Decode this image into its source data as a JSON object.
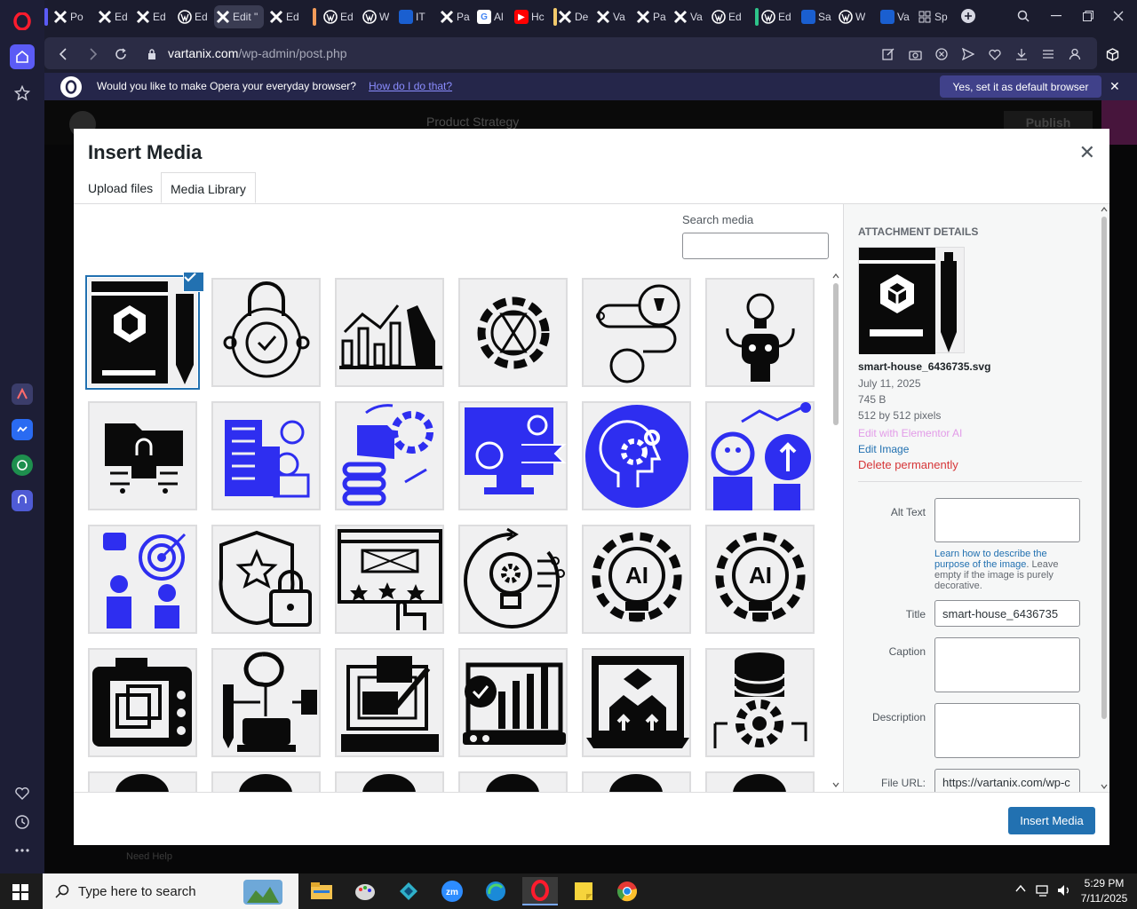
{
  "browser": {
    "tabs": [
      {
        "label": "Po",
        "icon": "elementor-x-icon"
      },
      {
        "label": "Ed",
        "icon": "elementor-x-icon"
      },
      {
        "label": "Ed",
        "icon": "elementor-x-icon"
      },
      {
        "label": "Ed",
        "icon": "wordpress-icon"
      },
      {
        "label": "Edit \"",
        "icon": "elementor-x-icon"
      },
      {
        "label": "Ed",
        "icon": "elementor-x-icon"
      },
      {
        "label": "Ed",
        "icon": "wordpress-icon"
      },
      {
        "label": "W",
        "icon": "wordpress-icon"
      },
      {
        "label": "IT",
        "icon": "blue-square-icon"
      },
      {
        "label": "Pa",
        "icon": "elementor-x-icon"
      },
      {
        "label": "Al",
        "icon": "google-icon"
      },
      {
        "label": "Hc",
        "icon": "youtube-icon"
      },
      {
        "label": "De",
        "icon": "elementor-x-icon"
      },
      {
        "label": "Va",
        "icon": "elementor-x-icon"
      },
      {
        "label": "Pa",
        "icon": "elementor-x-icon"
      },
      {
        "label": "Va",
        "icon": "elementor-x-icon"
      },
      {
        "label": "Ed",
        "icon": "wordpress-icon"
      },
      {
        "label": "Ed",
        "icon": "wordpress-icon"
      },
      {
        "label": "Sa",
        "icon": "blue-square-icon"
      },
      {
        "label": "W",
        "icon": "wordpress-icon"
      },
      {
        "label": "Va",
        "icon": "blue-square-icon"
      },
      {
        "label": "Sp",
        "icon": "grid-icon"
      }
    ],
    "url_domain": "vartanix.com",
    "url_path": "/wp-admin/post.php",
    "banner_text": "Would you like to make Opera your everyday browser?",
    "banner_link": "How do I do that?",
    "banner_button": "Yes, set it as default browser"
  },
  "editor": {
    "page_name": "Product Strategy",
    "publish": "Publish",
    "need_help": "Need Help"
  },
  "modal": {
    "title": "Insert Media",
    "tab_upload": "Upload files",
    "tab_library": "Media Library",
    "search_label": "Search media",
    "search_value": "",
    "insert_button": "Insert Media",
    "items": [
      {
        "name": "smart-house-icon",
        "color": "black",
        "selected": true
      },
      {
        "name": "security-lock-icon",
        "color": "black"
      },
      {
        "name": "data-analytics-icon",
        "color": "black"
      },
      {
        "name": "gear-hourglass-icon",
        "color": "black"
      },
      {
        "name": "strategy-path-icon",
        "color": "black"
      },
      {
        "name": "robot-idea-icon",
        "color": "black"
      },
      {
        "name": "folder-lock-icon",
        "color": "black"
      },
      {
        "name": "building-finance-icon",
        "color": "blue"
      },
      {
        "name": "data-stack-icon",
        "color": "blue"
      },
      {
        "name": "bitcoin-monitor-icon",
        "color": "blue"
      },
      {
        "name": "mind-gears-icon",
        "color": "blue"
      },
      {
        "name": "businessman-growth-icon",
        "color": "blue"
      },
      {
        "name": "team-target-icon",
        "color": "blue"
      },
      {
        "name": "shield-star-lock-icon",
        "color": "black"
      },
      {
        "name": "rating-browser-icon",
        "color": "black"
      },
      {
        "name": "idea-gear-cycle-icon",
        "color": "black"
      },
      {
        "name": "ai-bulb-icon",
        "color": "black"
      },
      {
        "name": "ai-bulb-icon",
        "color": "black"
      },
      {
        "name": "camera-layers-icon",
        "color": "black"
      },
      {
        "name": "brain-laptop-icon",
        "color": "black"
      },
      {
        "name": "code-design-icon",
        "color": "black"
      },
      {
        "name": "laptop-chart-icon",
        "color": "black"
      },
      {
        "name": "laptop-upload-icon",
        "color": "black"
      },
      {
        "name": "database-gear-icon",
        "color": "black"
      },
      {
        "name": "partial-icon",
        "color": "black"
      },
      {
        "name": "partial-icon",
        "color": "black"
      },
      {
        "name": "partial-icon",
        "color": "black"
      },
      {
        "name": "partial-icon",
        "color": "black"
      },
      {
        "name": "partial-icon",
        "color": "black"
      },
      {
        "name": "partial-icon",
        "color": "black"
      }
    ]
  },
  "details": {
    "heading": "Attachment Details",
    "filename": "smart-house_6436735.svg",
    "date": "July 11, 2025",
    "size": "745 B",
    "dimensions": "512 by 512 pixels",
    "edit_ai": "Edit with Elementor AI",
    "edit_image": "Edit Image",
    "delete": "Delete permanently",
    "alt_label": "Alt Text",
    "alt_value": "",
    "alt_help_link": "Learn how to describe the purpose of the image",
    "alt_help_text": ". Leave empty if the image is purely decorative.",
    "title_label": "Title",
    "title_value": "smart-house_6436735",
    "caption_label": "Caption",
    "caption_value": "",
    "description_label": "Description",
    "description_value": "",
    "url_label": "File URL:",
    "url_value": "https://vartanix.com/wp-c"
  },
  "taskbar": {
    "search_placeholder": "Type here to search",
    "time": "5:29 PM",
    "date": "7/11/2025"
  },
  "colors": {
    "wp_blue": "#2271b1",
    "icon_blue": "#2e2ef0",
    "delete_red": "#d63638",
    "ai_pink": "#d06bd8",
    "opera_red": "#ff1b2d"
  }
}
